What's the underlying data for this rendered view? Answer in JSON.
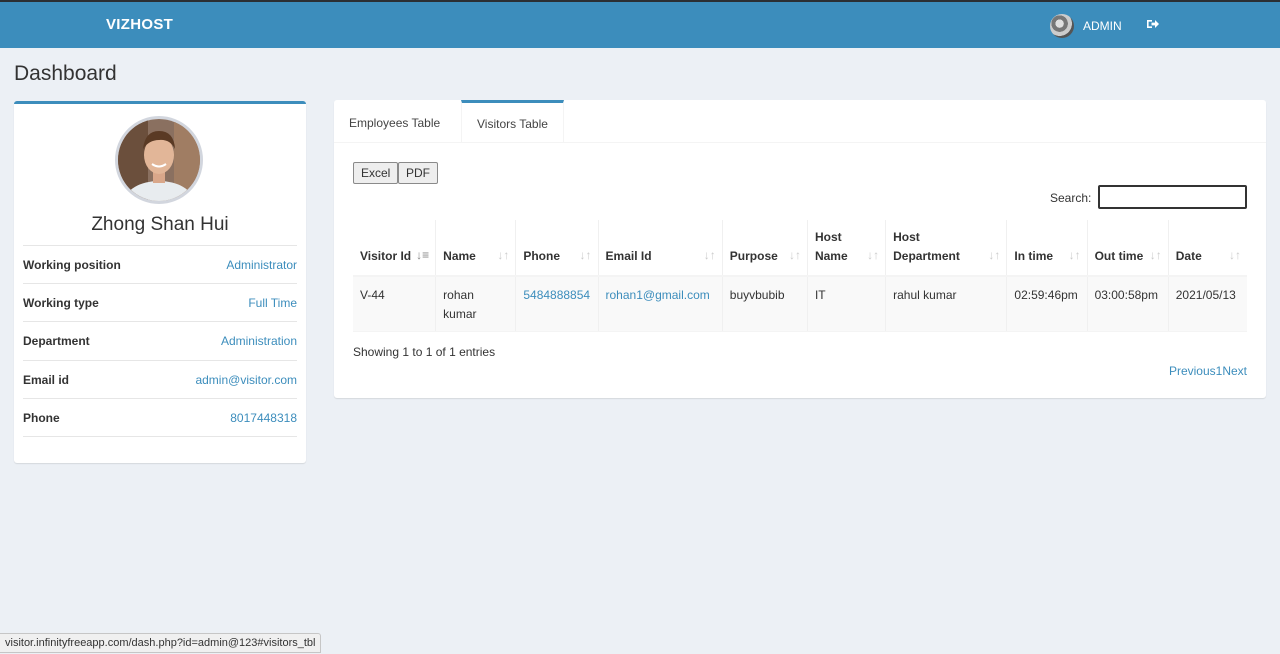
{
  "header": {
    "brand": "VIZHOST",
    "user_label": "ADMIN"
  },
  "page_title": "Dashboard",
  "profile": {
    "name": "Zhong Shan Hui",
    "rows": [
      {
        "label": "Working position",
        "value": "Administrator"
      },
      {
        "label": "Working type",
        "value": "Full Time"
      },
      {
        "label": "Department",
        "value": "Administration"
      },
      {
        "label": "Email id",
        "value": "admin@visitor.com"
      },
      {
        "label": "Phone",
        "value": "8017448318"
      }
    ]
  },
  "tabs": [
    {
      "label": "Employees Table",
      "active": false
    },
    {
      "label": "Visitors Table",
      "active": true
    }
  ],
  "toolbar": {
    "excel": "Excel",
    "pdf": "PDF",
    "search_label": "Search:",
    "search_value": ""
  },
  "table": {
    "columns": [
      "Visitor Id",
      "Name",
      "Phone",
      "Email Id",
      "Purpose",
      "Host Name",
      "Host Department",
      "In time",
      "Out time",
      "Date"
    ],
    "rows": [
      [
        "V-44",
        "rohan kumar",
        "5484888854",
        "rohan1@gmail.com",
        "buyvbubib",
        "IT",
        "rahul kumar",
        "02:59:46pm",
        "03:00:58pm",
        "2021/05/13"
      ]
    ]
  },
  "footer": {
    "info": "Showing 1 to 1 of 1 entries",
    "previous": "Previous",
    "page": "1",
    "next": "Next"
  },
  "status_url": "visitor.infinityfreeapp.com/dash.php?id=admin@123#visitors_tbl",
  "colors": {
    "header_bg": "#3c8dbc",
    "link": "#3c8dbc",
    "page_bg": "#ecf0f5"
  }
}
